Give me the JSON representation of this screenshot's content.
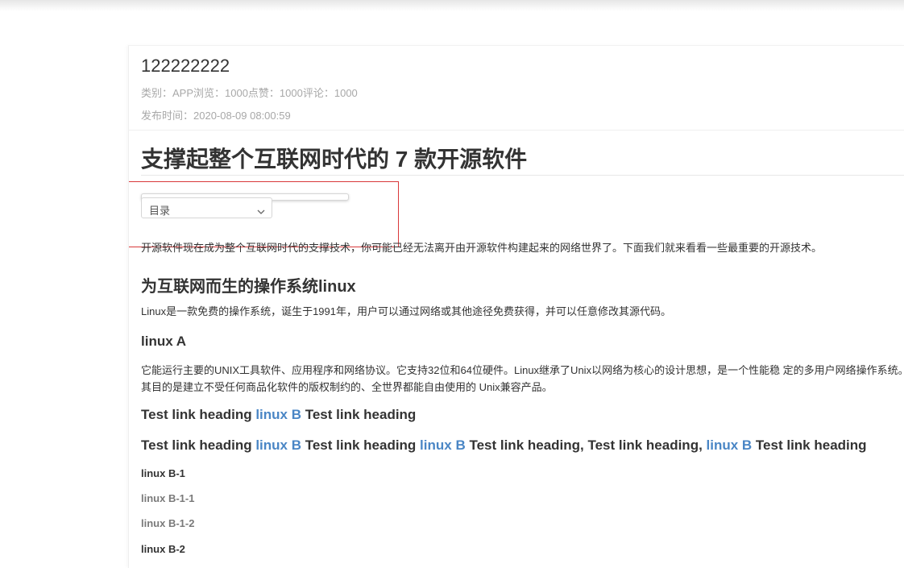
{
  "post": {
    "title": "122222222",
    "meta_category": "类别：APP浏览：1000点赞：1000评论：1000",
    "meta_published": "发布时间：2020-08-09 08:00:59"
  },
  "article": {
    "heading": "支撑起整个互联网时代的 7 款开源软件",
    "toc": {
      "selected": "目录"
    },
    "intro": "开源软件现在成为整个互联网时代的支撑技术，你可能已经无法离开由开源软件构建起来的网络世界了。下面我们就来看看一些最重要的开源技术。",
    "section_linux": {
      "heading": "为互联网而生的操作系统linux",
      "text": "Linux是一款免费的操作系统，诞生于1991年，用户可以通过网络或其他途径免费获得，并可以任意修改其源代码。"
    },
    "section_linux_a": {
      "heading": "linux A",
      "text_line1": "它能运行主要的UNIX工具软件、应用程序和网络协议。它支持32位和64位硬件。Linux继承了Unix以网络为核心的设计思想，是一个性能稳 定的多用户网络操作系统。这个",
      "text_line2": "其目的是建立不受任何商品化软件的版权制约的、全世界都能自由使用的 Unix兼容产品。"
    },
    "link_heading_1": {
      "part1": "Test link heading ",
      "link1": "linux B",
      "part2": " Test link heading"
    },
    "link_heading_2": {
      "part1": "Test link heading ",
      "link1": "linux B",
      "part2": " Test link heading ",
      "link2": "linux B",
      "part3": " Test link heading, Test link heading, ",
      "link3": "linux B",
      "part4": " Test link heading"
    },
    "sub_headings": {
      "b1": "linux B-1",
      "b1_1": "linux B-1-1",
      "b1_2": "linux B-1-2",
      "b2": "linux B-2"
    }
  },
  "colors": {
    "link": "#4a86c5",
    "highlight_border": "#d9383a",
    "meta_text": "#a8a8a8"
  },
  "icons": {
    "toc_chevron": "chevron-down-icon"
  }
}
